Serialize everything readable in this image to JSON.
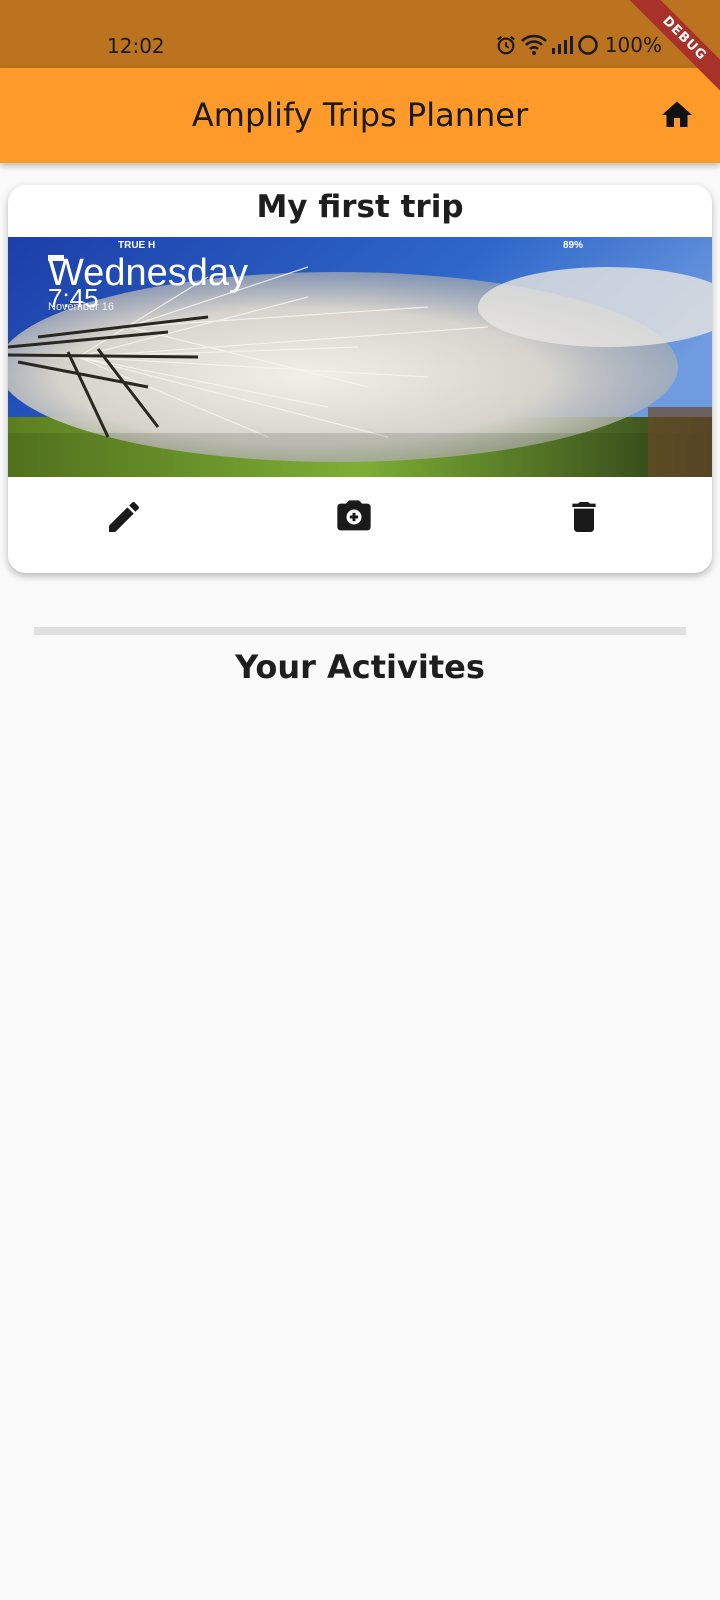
{
  "status_bar": {
    "time": "12:02",
    "battery": "100%"
  },
  "debug_banner": "DEBUG",
  "app_bar": {
    "title": "Amplify Trips Planner",
    "home_icon": "home-icon"
  },
  "trip_card": {
    "title": "My first trip",
    "image": {
      "carrier": "TRUE H",
      "battery": "89%",
      "weekday": "Wednesday",
      "time": "7:45",
      "date": "November 16"
    },
    "actions": [
      "edit-icon",
      "add-photo-icon",
      "delete-icon"
    ]
  },
  "activities": {
    "title": "Your Activites"
  },
  "colors": {
    "status_bar": "#bb731f",
    "app_bar": "#fd9a29",
    "background": "#fafafa",
    "debug_banner": "#a8322a"
  }
}
